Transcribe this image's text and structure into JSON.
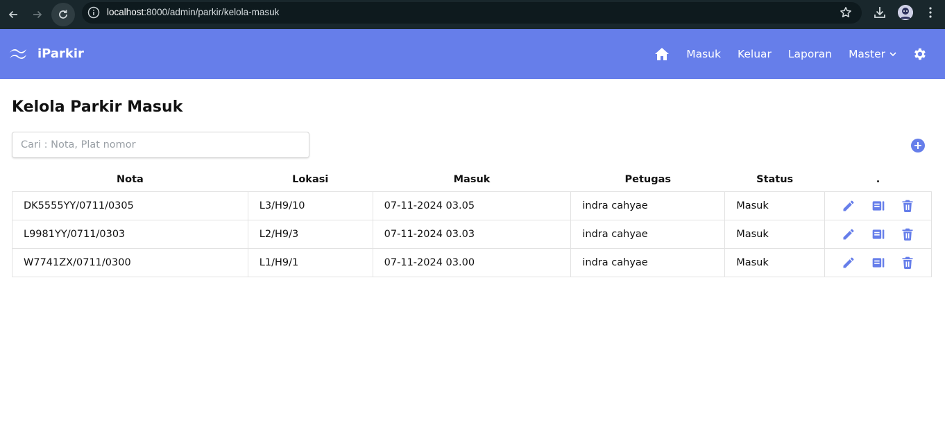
{
  "browser": {
    "url_host": "localhost",
    "url_rest": ":8000/admin/parkir/kelola-masuk"
  },
  "app": {
    "brand": "iParkir",
    "accent": "#667eea",
    "nav": {
      "masuk": "Masuk",
      "keluar": "Keluar",
      "laporan": "Laporan",
      "master": "Master"
    }
  },
  "page": {
    "title": "Kelola Parkir Masuk",
    "search_placeholder": "Cari : Nota, Plat nomor"
  },
  "table": {
    "headers": [
      "Nota",
      "Lokasi",
      "Masuk",
      "Petugas",
      "Status",
      "."
    ],
    "rows": [
      {
        "nota": "DK5555YY/0711/0305",
        "lokasi": "L3/H9/10",
        "masuk": "07-11-2024 03.05",
        "petugas": "indra cahyae",
        "status": "Masuk"
      },
      {
        "nota": "L9981YY/0711/0303",
        "lokasi": "L2/H9/3",
        "masuk": "07-11-2024 03.03",
        "petugas": "indra cahyae",
        "status": "Masuk"
      },
      {
        "nota": "W7741ZX/0711/0300",
        "lokasi": "L1/H9/1",
        "masuk": "07-11-2024 03.00",
        "petugas": "indra cahyae",
        "status": "Masuk"
      }
    ]
  },
  "icons": [
    "back-icon",
    "forward-icon",
    "reload-icon",
    "info-icon",
    "star-icon",
    "download-icon",
    "menu-icon",
    "wave-logo-icon",
    "home-icon",
    "chevron-down-icon",
    "gear-icon",
    "plus-circle-icon",
    "pencil-icon",
    "detail-icon",
    "trash-icon"
  ]
}
